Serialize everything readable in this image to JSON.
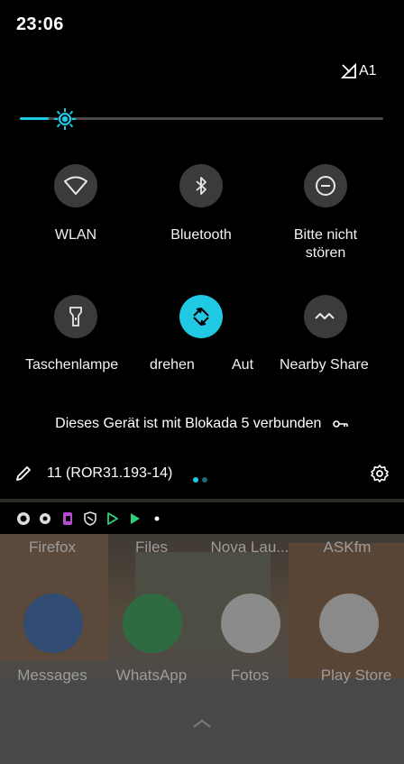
{
  "status_bar": {
    "time": "23:06",
    "carrier": "A1",
    "signal_icon": "signal-no-data-icon"
  },
  "brightness": {
    "level": 0.08,
    "accent": "#1fc8e3"
  },
  "tiles": [
    {
      "label": "WLAN",
      "icon": "wifi-icon",
      "active": false
    },
    {
      "label": "Bluetooth",
      "icon": "bluetooth-icon",
      "active": false
    },
    {
      "label_line1": "Bitte nicht",
      "label_line2": "stören",
      "icon": "do-not-disturb-icon",
      "active": false
    },
    {
      "label": "Taschenlampe",
      "icon": "flashlight-icon",
      "active": false
    },
    {
      "label_left": "drehen",
      "label_right": "Aut",
      "icon": "auto-rotate-icon",
      "active": true
    },
    {
      "label": "Nearby Share",
      "icon": "nearby-share-icon",
      "active": false
    }
  ],
  "vpn_notice": "Dieses Gerät ist mit Blokada 5 verbunden",
  "footer": {
    "build": "11 (ROR31.193-14)"
  },
  "notification_icons": [
    "firefox-focus-icon",
    "settings-icon",
    "media-icon",
    "shield-icon",
    "play-store-icon",
    "play-store-alt-icon",
    "more-dot-icon"
  ],
  "launcher": {
    "top_row": [
      "Firefox",
      "Files",
      "Nova Lau...",
      "ASKfm"
    ],
    "dock": [
      "Messages",
      "WhatsApp",
      "Fotos",
      "Play Store"
    ]
  }
}
